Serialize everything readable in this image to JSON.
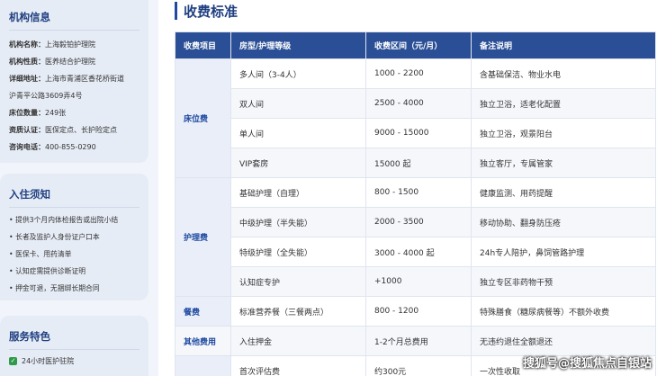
{
  "sidebar": {
    "org_info": {
      "title": "机构信息",
      "rows": [
        {
          "key": "机构名称：",
          "value": "上海毅铂护理院"
        },
        {
          "key": "机构性质：",
          "value": "医养结合护理院"
        },
        {
          "key": "详细地址：",
          "value": "上海市青浦区香花桥街道"
        },
        {
          "key": "",
          "value": "沪青平公路3609弄4号"
        },
        {
          "key": "床位数量：",
          "value": "249张"
        },
        {
          "key": "资质认证：",
          "value": "医保定点、长护险定点"
        },
        {
          "key": "咨询电话：",
          "value": "400-855-0290"
        }
      ]
    },
    "admission": {
      "title": "入住须知",
      "items": [
        "• 提供3个月内体检报告或出院小结",
        "• 长者及监护人身份证户口本",
        "• 医保卡、用药清单",
        "• 认知症需提供诊断证明",
        "• 押金可退，无捆绑长期合同"
      ]
    },
    "features": {
      "title": "服务特色",
      "items": [
        "24小时医护驻院"
      ]
    }
  },
  "main": {
    "title": "收费标准",
    "table": {
      "headers": [
        "收费项目",
        "房型/护理等级",
        "收费区间（元/月）",
        "备注说明"
      ],
      "rows": [
        {
          "cat": "床位费",
          "span": 4,
          "cells": [
            "多人间（3-4人）",
            "1000 - 2200",
            "含基础保洁、物业水电"
          ]
        },
        {
          "cells": [
            "双人间",
            "2500 - 4000",
            "独立卫浴，适老化配置"
          ]
        },
        {
          "cells": [
            "单人间",
            "9000 - 15000",
            "独立卫浴，观景阳台"
          ]
        },
        {
          "cells": [
            "VIP套房",
            "15000 起",
            "独立客厅，专属管家"
          ]
        },
        {
          "cat": "护理费",
          "span": 4,
          "cells": [
            "基础护理（自理）",
            "800 - 1500",
            "健康监测、用药提醒"
          ]
        },
        {
          "cells": [
            "中级护理（半失能）",
            "2000 - 3500",
            "移动协助、翻身防压疮"
          ]
        },
        {
          "cells": [
            "特级护理（全失能）",
            "3000 - 4000 起",
            "24h专人陪护，鼻饲管路护理"
          ]
        },
        {
          "cells": [
            "认知症专护",
            "+1000",
            "独立专区非药物干预"
          ]
        },
        {
          "cat": "餐费",
          "span": 1,
          "cells": [
            "标准营养餐（三餐两点）",
            "800 - 1200",
            "特殊膳食（糖尿病餐等）不额外收费"
          ]
        },
        {
          "cat": "其他费用",
          "span": 1,
          "cells": [
            "入住押金",
            "1-2个月总费用",
            "无违约退住全额退还"
          ]
        },
        {
          "cat": "",
          "span": 1,
          "cells": [
            "首次评估费",
            "约300元",
            "一次性收取"
          ]
        }
      ]
    }
  },
  "watermark": "搜狐号@搜狐焦点自银站"
}
